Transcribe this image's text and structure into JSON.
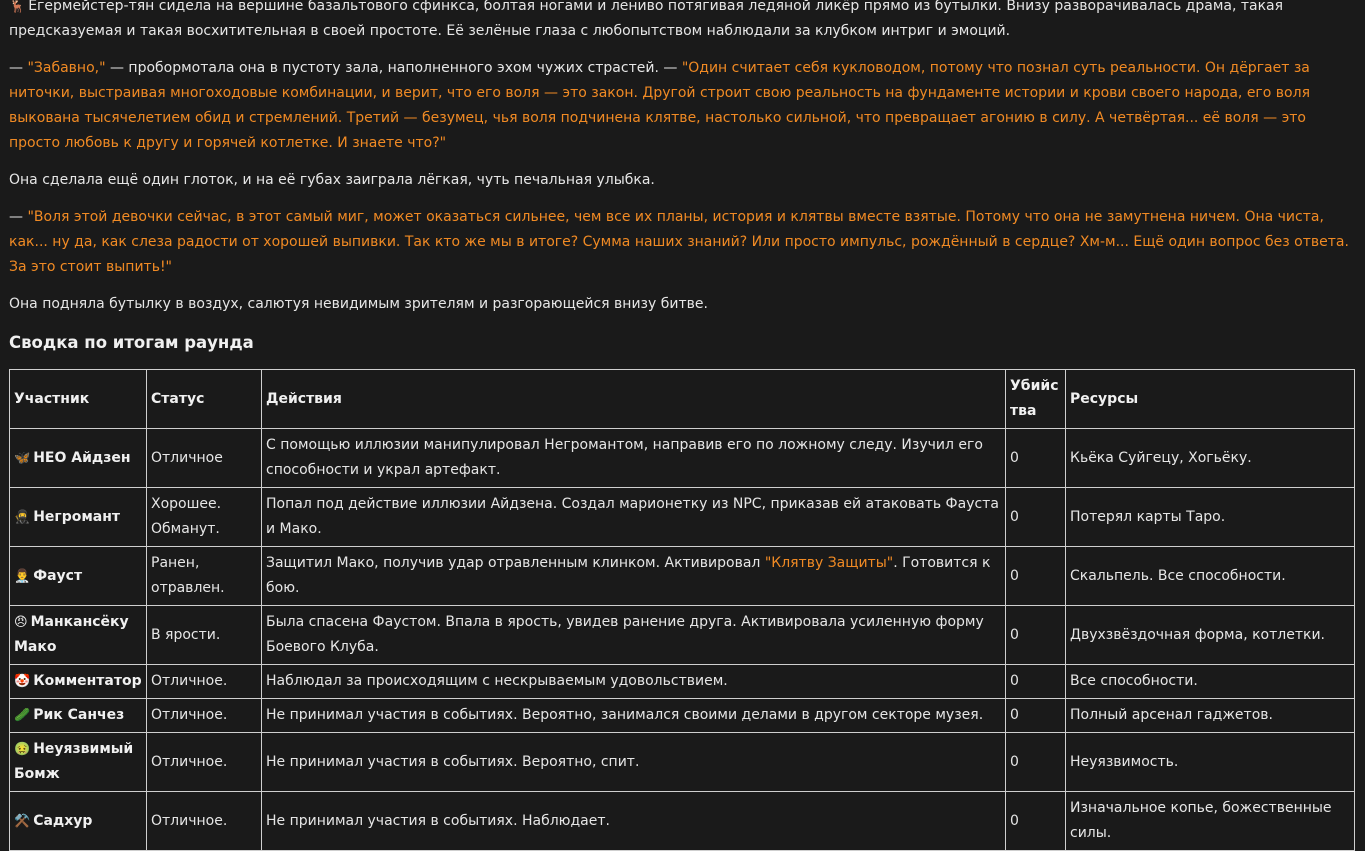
{
  "story": {
    "p1": "Егермейстер-тян сидела на вершине базальтового сфинкса, болтая ногами и лениво потягивая ледяной ликёр прямо из бутылки. Внизу разворачивалась драма, такая предсказуемая и такая восхитительная в своей простоте. Её зелёные глаза с любопытством наблюдали за клубком интриг и эмоций.",
    "p1_icon": "🦌",
    "p2_dash": "— ",
    "p2_quote1": "\"Забавно,\"",
    "p2_mid": " — пробормотала она в пустоту зала, наполненного эхом чужих страстей. — ",
    "p2_quote2": "\"Один считает себя кукловодом, потому что познал суть реальности. Он дёргает за ниточки, выстраивая многоходовые комбинации, и верит, что его воля — это закон. Другой строит свою реальность на фундаменте истории и крови своего народа, его воля выкована тысячелетием обид и стремлений. Третий — безумец, чья воля подчинена клятве, настолько сильной, что превращает агонию в силу. А четвёртая... её воля — это просто любовь к другу и горячей котлетке. И знаете что?\"",
    "p3": "Она сделала ещё один глоток, и на её губах заиграла лёгкая, чуть печальная улыбка.",
    "p4_dash": "— ",
    "p4_quote": "\"Воля этой девочки сейчас, в этот самый миг, может оказаться сильнее, чем все их планы, история и клятвы вместе взятые. Потому что она не замутнена ничем. Она чиста, как... ну да, как слеза радости от хорошей выпивки. Так кто же мы в итоге? Сумма наших знаний? Или просто импульс, рождённый в сердце? Хм-м... Ещё один вопрос без ответа. За это стоит выпить!\"",
    "p5": "Она подняла бутылку в воздух, салютуя невидимым зрителям и разгорающейся внизу битве."
  },
  "summary": {
    "title": "Сводка по итогам раунда",
    "headers": {
      "participant": "Участник",
      "status": "Статус",
      "actions": "Действия",
      "kills": "Убийства",
      "resources": "Ресурсы"
    },
    "rows": [
      {
        "icon": "🦋",
        "name": "НЕО Айдзен",
        "status": "Отличное",
        "actions": "С помощью иллюзии манипулировал Негромантом, направив его по ложному следу. Изучил его способности и украл артефакт.",
        "kills": "0",
        "resources": "Кьёка Суйгецу, Хогьёку."
      },
      {
        "icon": "🥷",
        "name": "Негромант",
        "status": "Хорошее. Обманут.",
        "actions": "Попал под действие иллюзии Айдзена. Создал марионетку из NPC, приказав ей атаковать Фауста и Мако.",
        "kills": "0",
        "resources": "Потерял карты Таро."
      },
      {
        "icon": "👨‍⚕️",
        "name": "Фауст",
        "status": "Ранен, отравлен.",
        "actions_pre": "Защитил Мако, получив удар отравленным клинком. Активировал ",
        "actions_hl": "\"Клятву Защиты\"",
        "actions_post": ". Готовится к бою.",
        "kills": "0",
        "resources": "Скальпель. Все способности."
      },
      {
        "icon": "😠",
        "name": "Манкансёку Мако",
        "status": "В ярости.",
        "actions": "Была спасена Фаустом. Впала в ярость, увидев ранение друга. Активировала усиленную форму Боевого Клуба.",
        "kills": "0",
        "resources": "Двухзвёздочная форма, котлетки."
      },
      {
        "icon": "🤡",
        "name": "Комментатор",
        "status": "Отличное.",
        "actions": "Наблюдал за происходящим с нескрываемым удовольствием.",
        "kills": "0",
        "resources": "Все способности."
      },
      {
        "icon": "🥒",
        "name": "Рик Санчез",
        "status": "Отличное.",
        "actions": "Не принимал участия в событиях. Вероятно, занимался своими делами в другом секторе музея.",
        "kills": "0",
        "resources": "Полный арсенал гаджетов."
      },
      {
        "icon": "🤢",
        "name": "Неуязвимый Бомж",
        "status": "Отличное.",
        "actions": "Не принимал участия в событиях. Вероятно, спит.",
        "kills": "0",
        "resources": "Неуязвимость."
      },
      {
        "icon": "⚒️",
        "name": "Садхур",
        "status": "Отличное.",
        "actions": "Не принимал участия в событиях. Наблюдает.",
        "kills": "0",
        "resources": "Изначальное копье, божественные силы."
      }
    ]
  }
}
